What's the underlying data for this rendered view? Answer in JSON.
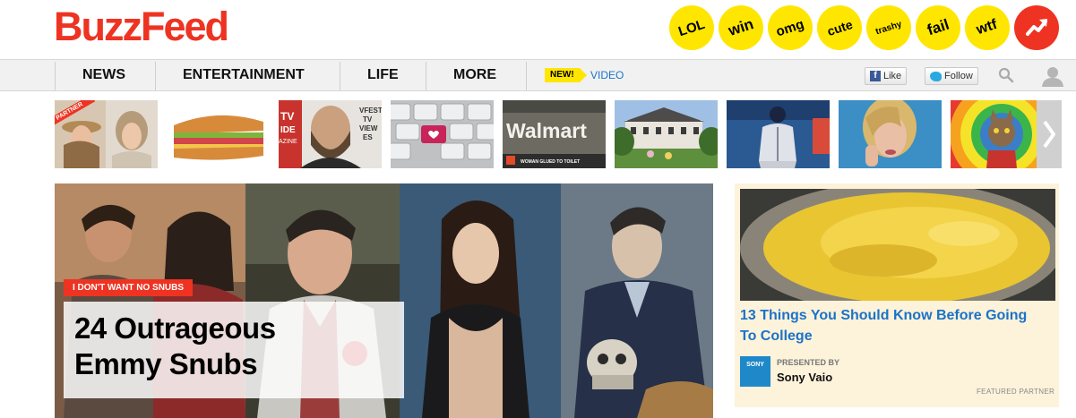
{
  "brand": {
    "logo_text": "BuzzFeed",
    "accent": "#ee3322",
    "badge_yellow": "#ffe600",
    "link_blue": "#1a73c8"
  },
  "badges": [
    {
      "label": "LOL",
      "font_size": "15"
    },
    {
      "label": "win",
      "font_size": "17"
    },
    {
      "label": "omg",
      "font_size": "15"
    },
    {
      "label": "cute",
      "font_size": "14"
    },
    {
      "label": "trashy",
      "font_size": "10"
    },
    {
      "label": "fail",
      "font_size": "17"
    },
    {
      "label": "wtf",
      "font_size": "16"
    },
    {
      "label": "trending-arrow-icon"
    }
  ],
  "nav": {
    "items": [
      {
        "label": "NEWS"
      },
      {
        "label": "ENTERTAINMENT"
      },
      {
        "label": "LIFE"
      },
      {
        "label": "MORE"
      }
    ],
    "new_badge": "NEW!",
    "video_link": "VIDEO",
    "like_label": "Like",
    "follow_label": "Follow"
  },
  "thumbs": {
    "partner_label": "PARTNER",
    "walmart_text": "Walmart",
    "walmart_caption": "WOMAN GLUED TO TOILET",
    "magazine_text": "TV\nIDE\nAZINE",
    "fest_text": "VFEST\nTV\nVIEW\nES"
  },
  "feature": {
    "tag": "I DON'T WANT NO SNUBS",
    "headline_line1": "24 Outrageous",
    "headline_line2": "Emmy Snubs"
  },
  "ad": {
    "title": "13 Things You Should Know Before Going To College",
    "presented_by": "PRESENTED BY",
    "sponsor": "Sony Vaio",
    "sony_logo": "SONY",
    "featured_label": "FEATURED PARTNER"
  }
}
